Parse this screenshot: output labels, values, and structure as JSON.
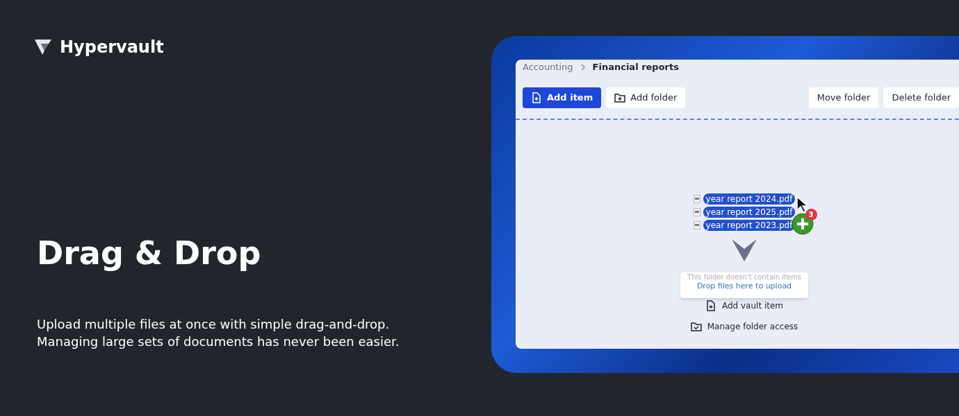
{
  "brand": {
    "name": "Hypervault"
  },
  "headline": "Drag & Drop",
  "description": [
    "Upload multiple files at once with simple drag-and-drop.",
    "Managing large sets of documents has never been easier."
  ],
  "app": {
    "breadcrumb": [
      {
        "label": "Accounting",
        "current": false
      },
      {
        "label": "Financial reports",
        "current": true
      }
    ],
    "toolbar_left": [
      {
        "label": "Add item",
        "kind": "primary"
      },
      {
        "label": "Add folder",
        "kind": "secondary"
      }
    ],
    "toolbar_right": [
      {
        "label": "Move folder",
        "kind": "secondary"
      },
      {
        "label": "Delete folder",
        "kind": "secondary"
      }
    ],
    "dragged_files": [
      "year report 2024.pdf",
      "year report 2025.pdf",
      "year report 2023.pdf"
    ],
    "drag_count": "3",
    "empty_message": "This folder doesn't contain items",
    "drop_hint": "Drop files here to upload",
    "actions": [
      "Add vault item",
      "Manage folder access"
    ]
  }
}
